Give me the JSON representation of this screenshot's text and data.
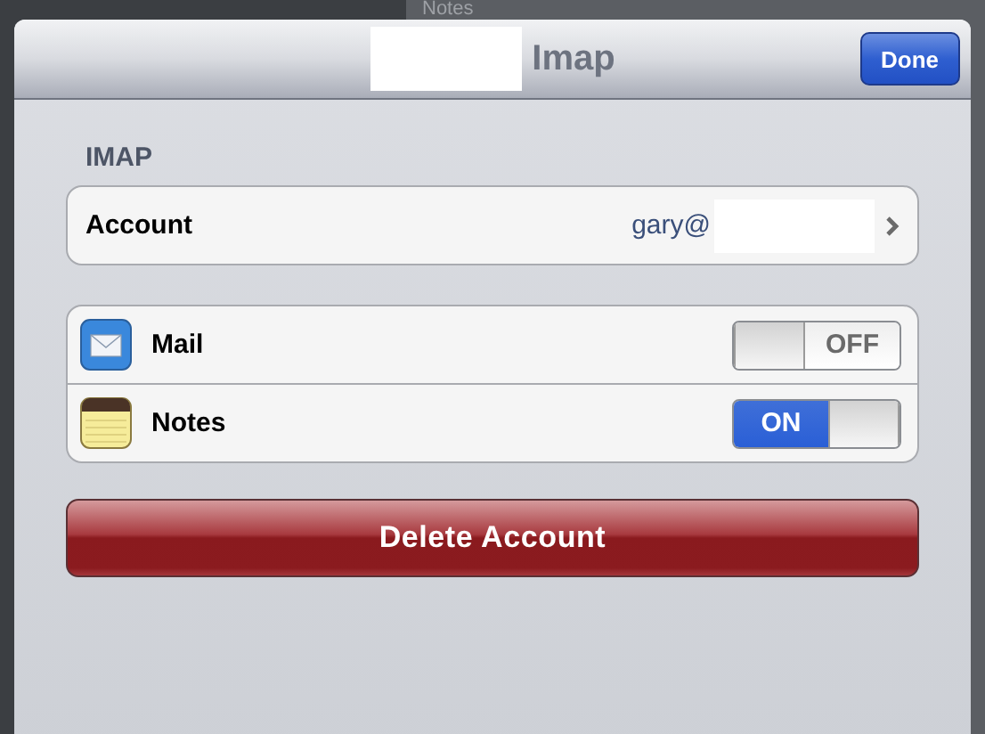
{
  "background": {
    "title": "Notes"
  },
  "dialog": {
    "title": "Imap",
    "done_button": "Done"
  },
  "section_header": "IMAP",
  "account": {
    "label": "Account",
    "value": "gary@"
  },
  "services": [
    {
      "kind": "mail",
      "label": "Mail",
      "on": false,
      "switch_text": "OFF"
    },
    {
      "kind": "notes",
      "label": "Notes",
      "on": true,
      "switch_text": "ON"
    }
  ],
  "delete_button": "Delete Account"
}
